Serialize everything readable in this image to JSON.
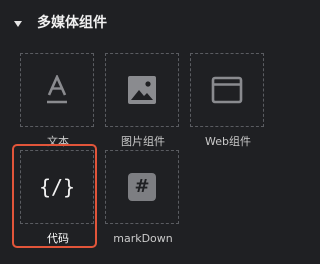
{
  "section": {
    "title": "多媒体组件",
    "caret_icon": "caret-down-icon"
  },
  "items": [
    {
      "label": "文本",
      "icon": "text-icon"
    },
    {
      "label": "图片组件",
      "icon": "image-icon"
    },
    {
      "label": "Web组件",
      "icon": "browser-window-icon"
    },
    {
      "label": "代码",
      "icon": "code-icon",
      "glyph": "{/}",
      "selected": true
    },
    {
      "label": "markDown",
      "icon": "hash-icon",
      "glyph": "#"
    }
  ],
  "colors": {
    "background": "#1f2023",
    "selection_border": "#e2553a",
    "icon_gray": "#7d7e82",
    "tile_border": "#5a5c61"
  }
}
